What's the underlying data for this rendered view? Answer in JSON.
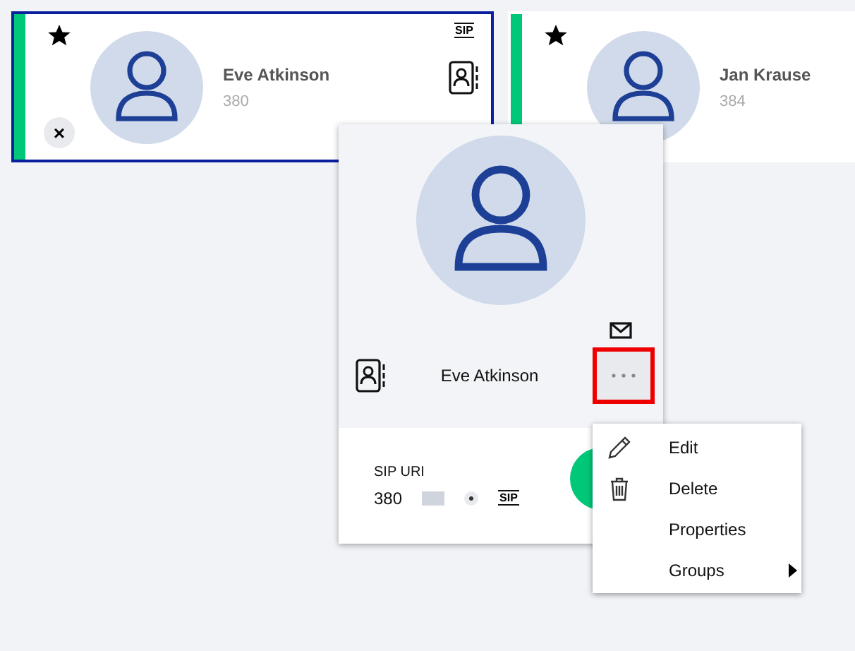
{
  "contacts": [
    {
      "name": "Eve Atkinson",
      "number": "380",
      "selected": true,
      "favorite": true,
      "sip_badge": "SIP",
      "remove": "×",
      "color": "#00c878"
    },
    {
      "name": "Jan Krause",
      "number": "384",
      "selected": false,
      "favorite": true,
      "color": "#00c878"
    }
  ],
  "detail": {
    "name": "Eve Atkinson",
    "field_label": "SIP URI",
    "field_value": "380",
    "sip_badge": "SIP"
  },
  "menu": [
    {
      "label": "Edit",
      "kind": "edit"
    },
    {
      "label": "Delete",
      "kind": "delete"
    },
    {
      "label": "Properties",
      "kind": "plain"
    },
    {
      "label": "Groups",
      "kind": "submenu"
    }
  ]
}
